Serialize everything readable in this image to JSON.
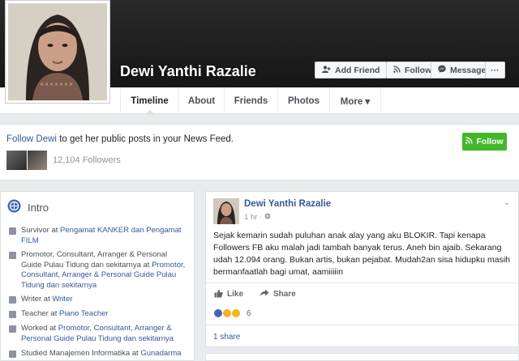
{
  "profile": {
    "name": "Dewi Yanthi Razalie"
  },
  "cover_buttons": {
    "add_friend": "Add Friend",
    "follow": "Follow",
    "message": "Message",
    "more": "···"
  },
  "tabs": [
    {
      "label": "Timeline"
    },
    {
      "label": "About"
    },
    {
      "label": "Friends"
    },
    {
      "label": "Photos"
    },
    {
      "label": "More ▾"
    }
  ],
  "follow_prompt": {
    "link": "Follow Dewi",
    "text": " to get her public posts in your News Feed.",
    "button": "Follow",
    "followers": "12,104 Followers"
  },
  "intro": {
    "title": "Intro",
    "items": [
      {
        "prefix": "Survivor at ",
        "link": "Pengamat KANKER dan Pengamat FILM"
      },
      {
        "prefix": "Promotor, Consultant, Arranger & Personal Guide Pulau Tidung dan sekitarnya at ",
        "link": "Promotor, Consultant, Arranger & Personal Guide Pulau Tidung dan sekitarnya"
      },
      {
        "prefix": "Writer at ",
        "link": "Writer"
      },
      {
        "prefix": "Teacher at ",
        "link": "Piano Teacher"
      },
      {
        "prefix": "Worked at ",
        "link": "Promotor, Consultant, Arranger & Personal Guide Pulau Tidung dan sekitarnya"
      },
      {
        "prefix": "Studied Manajemen Informatika at ",
        "link": "Gunadarma"
      }
    ]
  },
  "post": {
    "author": "Dewi Yanthi Razalie",
    "time": "1 hr ·",
    "body": "Sejak kemarin sudah puluhan anak alay yang aku BLOKIR. Tapi kenapa Followers FB aku malah jadi tambah banyak terus. Aneh bin ajaib. Sekarang udah 12.094 orang. Bukan artis, bukan pejabat. Mudah2an sisa hidupku masih bermanfaatlah bagi umat, aamiiiiin",
    "like": "Like",
    "share": "Share",
    "reaction_count": "6",
    "shares": "1 share"
  },
  "colors": {
    "fb_blue": "#365899",
    "green": "#42b72a"
  }
}
